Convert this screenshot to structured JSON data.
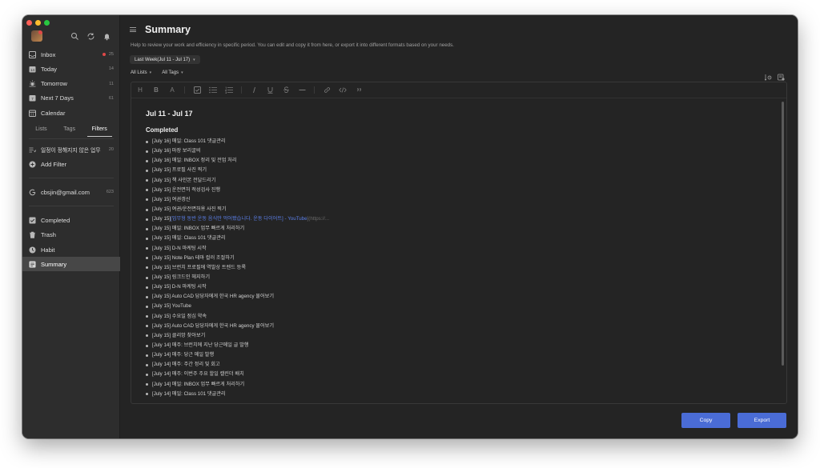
{
  "sidebar": {
    "nav": [
      {
        "label": "Inbox",
        "count": "25",
        "icon": "inbox-icon",
        "dot": true
      },
      {
        "label": "Today",
        "count": "14",
        "icon": "today-icon"
      },
      {
        "label": "Tomorrow",
        "count": "11",
        "icon": "tomorrow-icon"
      },
      {
        "label": "Next 7 Days",
        "count": "61",
        "icon": "next-7-days-icon"
      },
      {
        "label": "Calendar",
        "count": "",
        "icon": "calendar-icon"
      }
    ],
    "tabs": [
      "Lists",
      "Tags",
      "Filters"
    ],
    "active_tab": "Filters",
    "filter_item": {
      "label": "일정이 정해지지 않은 업무",
      "count": "20"
    },
    "add_filter": "Add Filter",
    "account": {
      "label": "cbsjin@gmail.com",
      "count": "623"
    },
    "bottom": [
      {
        "label": "Completed",
        "icon": "completed-icon"
      },
      {
        "label": "Trash",
        "icon": "trash-icon"
      },
      {
        "label": "Habit",
        "icon": "habit-icon"
      },
      {
        "label": "Summary",
        "icon": "summary-icon",
        "active": true
      }
    ]
  },
  "main": {
    "title": "Summary",
    "subtitle": "Help to review your work and efficiency in specific period. You can edit and copy it from here, or export it into different formats based on your needs.",
    "period": "Last Week(Jul 11 - Jul 17)",
    "lists_filter": "All Lists",
    "tags_filter": "All Tags",
    "toolbar": [
      "H",
      "B",
      "A"
    ],
    "doc": {
      "heading": "Jul 11 - Jul 17",
      "section": "Completed",
      "items": [
        "[July 16] 매일: Class 101 댓글관리",
        "[July 16] 마장 보리굴비",
        "[July 16] 매일: INBOX 정리 및 전업 처리",
        "[July 15] 프로필 사진 찍기",
        "[July 15] 책 사인본 전달드리기",
        "[July 15] 운전면허 적성검사 진행",
        "[July 15] 여권갱신",
        "[July 15] 여권/운전면허용 사진 찍기",
        "[July 15] ",
        "[July 15] 매일: INBOX 업무 빠르게 처리하기",
        "[July 15] 매일: Class 101 댓글관리",
        "[July 15] D-N 마케팅 시작",
        "[July 15] Note Plan 테마 컬러 조절하기",
        "[July 15] 브런치 프로필에 역발상 트렌드 등록",
        "[July 15] 링크드인 헤지하기",
        "[July 15] D-N 마케팅 시작",
        "[July 15] Auto CAD 담당자에게 한국 HR agency 물어보기",
        "[July 15] YouTube",
        "[July 15] 수요일 점심 약속",
        "[July 15] Auto CAD 담당자에게 한국 HR agency 물어보기",
        "[July 15] 클리앙 찾아보기",
        "[July 14] 매주: 브런치에 지난 당근메일 글 발행",
        "[July 14] 매주: 당근 메일 발행",
        "[July 14] 매주: 주간 정리 및 회고",
        "[July 14] 매주: 이번주 주요 할일 캘린더 배치",
        "[July 14] 매일: INBOX 업무 빠르게 처리하기",
        "[July 14] 매일: Class 101 댓글관리"
      ],
      "link_item": {
        "prefix": "[July 15] ",
        "link": "[업무형 동반 운동 음식만 먹어봤습니다. 운동 다이어트] - YouTube",
        "suffix": "](https://..."
      }
    },
    "copy_label": "Copy",
    "export_label": "Export"
  },
  "colors": {
    "accent": "#4a6cd6",
    "link": "#5b7fe8",
    "badge": "#e04848"
  }
}
